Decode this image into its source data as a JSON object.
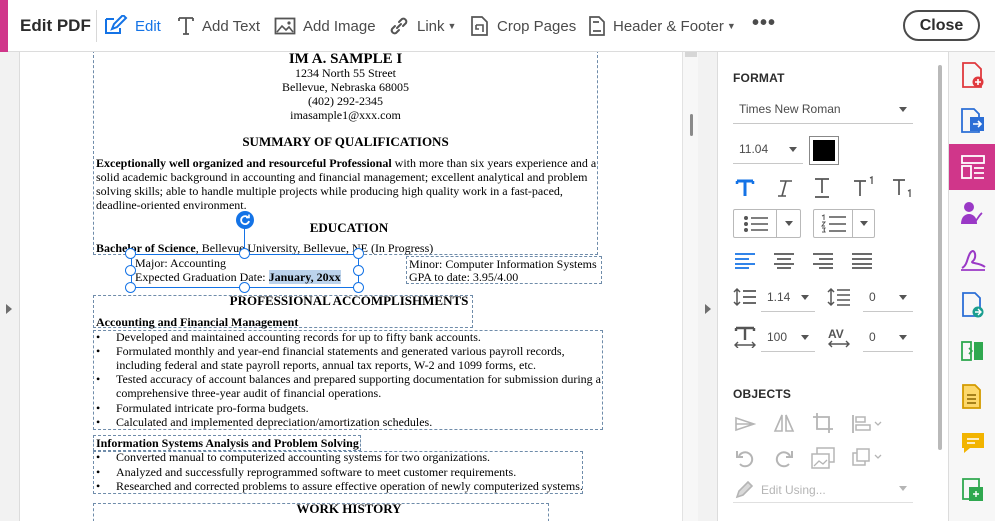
{
  "colors": {
    "accent": "#d0368a",
    "active_blue": "#1473e6"
  },
  "toolbar": {
    "title": "Edit PDF",
    "edit_label": "Edit",
    "add_text_label": "Add Text",
    "add_image_label": "Add Image",
    "link_label": "Link",
    "crop_label": "Crop Pages",
    "header_footer_label": "Header & Footer",
    "more_label": "•••",
    "close_label": "Close"
  },
  "document": {
    "name": "IM A. SAMPLE I",
    "address1": "1234 North 55 Street",
    "address2": "Bellevue, Nebraska 68005",
    "phone": "(402) 292-2345",
    "email": "imasample1@xxx.com",
    "summary_heading": "SUMMARY OF QUALIFICATIONS",
    "summary_bold": "Exceptionally well organized and resourceful Professional",
    "summary_line1_rest": " with more than six years experience and a",
    "summary_line2": "solid academic background in accounting and financial management; excellent analytical and problem",
    "summary_line3": "solving skills; able to handle multiple projects while producing high quality work in a fast-paced,",
    "summary_line4": "deadline-oriented environment.",
    "education_heading": "EDUCATION",
    "degree_bold": "Bachelor of Science",
    "degree_rest": ", Bellevue University, Bellevue, NE (In Progress)",
    "major": "Major:  Accounting",
    "grad_label": "Expected Graduation Date:  ",
    "grad_date": "January, 20xx",
    "minor": "Minor:  Computer Information Systems",
    "gpa": "GPA to date:  3.95/4.00",
    "accomplishments_heading": "PROFESSIONAL ACCOMPLISHMENTS",
    "acct_subheading": "Accounting and Financial Management",
    "acct_bullets": [
      "Developed and maintained accounting records for up to fifty bank accounts.",
      "Formulated monthly and year-end financial statements and generated various payroll records,",
      "including federal and state payroll reports, annual tax reports, W-2 and 1099 forms, etc.",
      "Tested accuracy of account balances and prepared supporting documentation for submission during a",
      "comprehensive three-year audit of financial operations.",
      "Formulated intricate pro-forma budgets.",
      "Calculated and implemented depreciation/amortization schedules."
    ],
    "is_subheading": "Information Systems Analysis and Problem Solving",
    "is_bullets": [
      "Converted manual to computerized accounting systems for two organizations.",
      "Analyzed and successfully reprogrammed software to meet customer requirements.",
      "Researched and corrected problems to assure effective operation of newly computerized systems."
    ],
    "work_heading": "WORK HISTORY",
    "bullet_char": "•"
  },
  "format_panel": {
    "format_title": "FORMAT",
    "font_family": "Times New Roman",
    "font_size": "11.04",
    "color_swatch": "#000000",
    "line_spacing": "1.14",
    "paragraph_spacing": "0",
    "horizontal_scale": "100",
    "char_spacing": "0",
    "objects_title": "OBJECTS",
    "edit_using": "Edit Using..."
  },
  "rail": {
    "icons": [
      "create-pdf-icon",
      "export-pdf-icon",
      "edit-pdf-icon",
      "request-signature-icon",
      "fill-sign-icon",
      "share-icon",
      "organize-pages-icon",
      "scan-icon",
      "comment-icon",
      "compress-icon"
    ]
  }
}
